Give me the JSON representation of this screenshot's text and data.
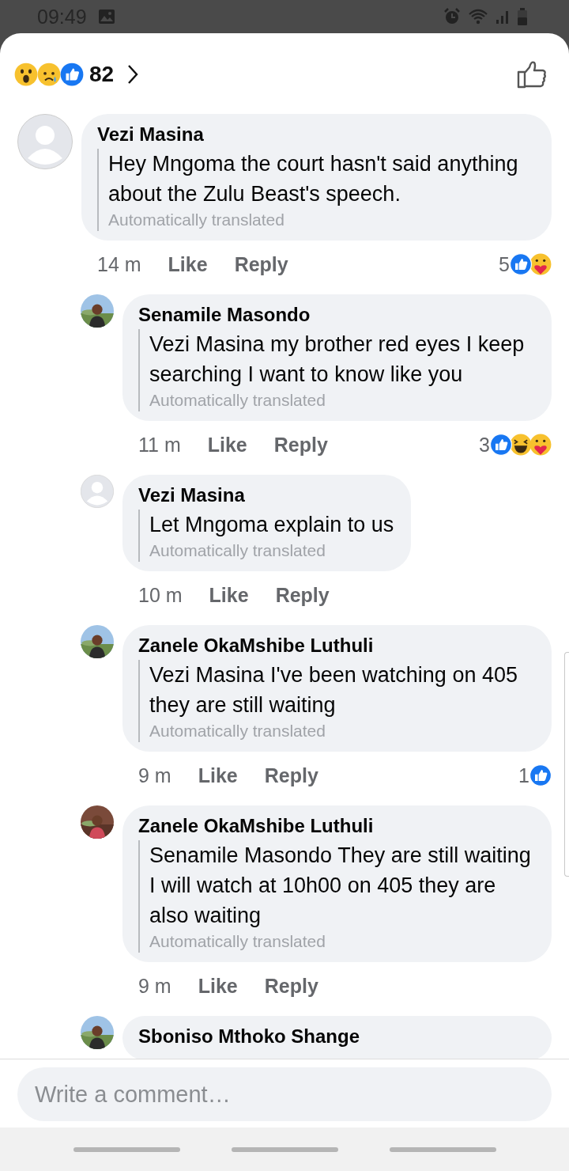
{
  "status_bar": {
    "time": "09:49"
  },
  "header": {
    "reactions": [
      {
        "kind": "wow"
      },
      {
        "kind": "sad"
      },
      {
        "kind": "like"
      }
    ],
    "count": "82"
  },
  "comments": [
    {
      "kind": "comment",
      "avatar": {
        "kind": "silhouette"
      },
      "author": "Vezi Masina",
      "text": "Hey Mngoma the court hasn't said anything about the Zulu Beast's speech.",
      "note": "Automatically translated",
      "time": "14 m",
      "actions": [
        "Like",
        "Reply"
      ],
      "reaction_count": "5",
      "reactions": [
        {
          "kind": "like"
        },
        {
          "kind": "care"
        }
      ]
    },
    {
      "kind": "reply",
      "avatar": {
        "kind": "picture"
      },
      "author": "Senamile Masondo",
      "text": "Vezi Masina my brother red eyes I keep searching I want to know like you",
      "note": "Automatically translated",
      "time": "11 m",
      "actions": [
        "Like",
        "Reply"
      ],
      "reaction_count": "3",
      "reactions": [
        {
          "kind": "like"
        },
        {
          "kind": "haha"
        },
        {
          "kind": "care"
        }
      ]
    },
    {
      "kind": "reply",
      "avatar": {
        "kind": "silhouette"
      },
      "author": "Vezi Masina",
      "text": "Let Mngoma explain to us",
      "note": "Automatically translated",
      "time": "10 m",
      "actions": [
        "Like",
        "Reply"
      ]
    },
    {
      "kind": "reply",
      "avatar": {
        "kind": "picture"
      },
      "author": "Zanele OkaMshibe Luthuli",
      "text": "Vezi Masina I've been watching on 405 they are still waiting",
      "note": "Automatically translated",
      "time": "9 m",
      "actions": [
        "Like",
        "Reply"
      ],
      "reaction_count": "1",
      "reactions": [
        {
          "kind": "like"
        }
      ]
    },
    {
      "kind": "reply",
      "avatar": {
        "kind": "picture"
      },
      "author": "Zanele OkaMshibe Luthuli",
      "text": "Senamile Masondo They are still waiting I will watch at 10h00 on 405 they are also waiting",
      "note": "Automatically translated",
      "time": "9 m",
      "actions": [
        "Like",
        "Reply"
      ]
    },
    {
      "kind": "reply",
      "avatar": {
        "kind": "picture"
      },
      "author": "Sboniso Mthoko Shange"
    }
  ],
  "composer": {
    "placeholder": "Write a comment…"
  }
}
